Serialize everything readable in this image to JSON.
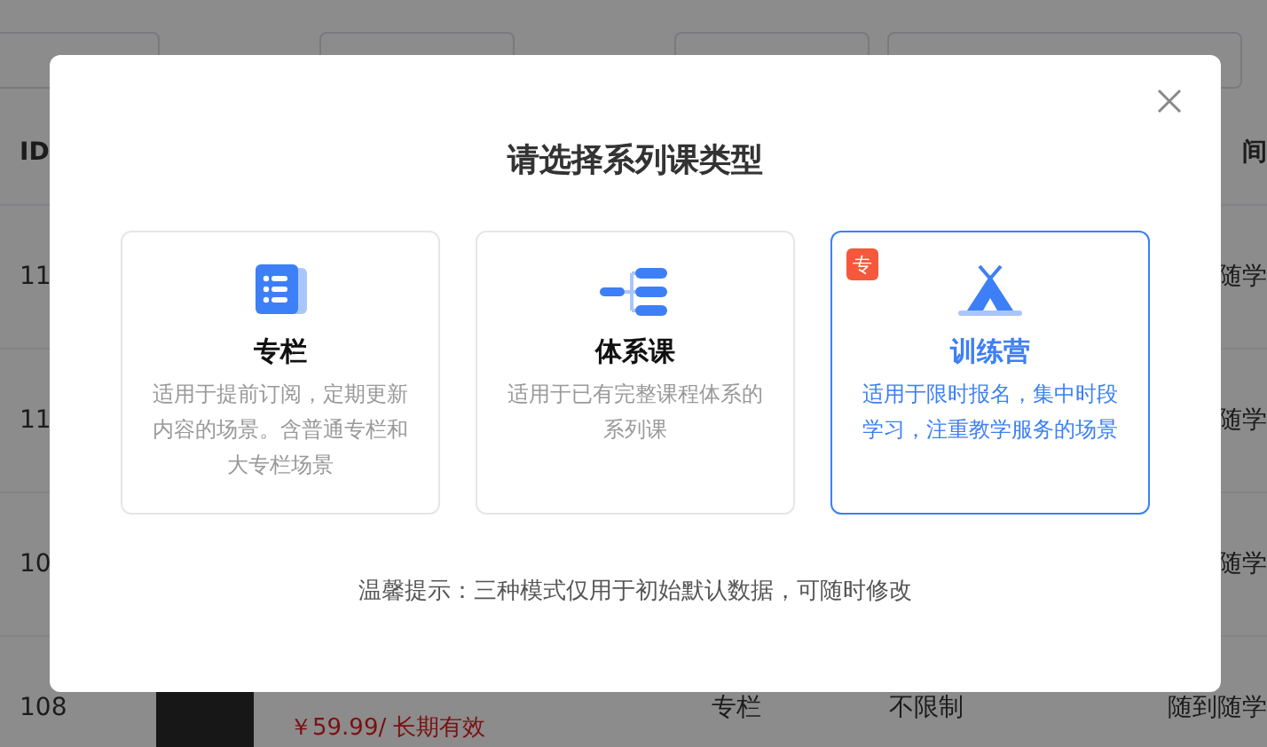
{
  "filters": [
    {
      "kind": "select"
    },
    {
      "kind": "select"
    },
    {
      "kind": "select"
    }
  ],
  "table": {
    "columns": [
      "ID",
      "间"
    ],
    "rows": [
      {
        "id": "11",
        "column_5": "随学"
      },
      {
        "id": "11",
        "column_5": "随学"
      },
      {
        "id": "10",
        "column_5": "随学"
      },
      {
        "id": "108",
        "price": "￥59.99/ 长期有效",
        "type": "专栏",
        "limit": "不限制",
        "column_5": "随到随学"
      }
    ]
  },
  "dialog": {
    "title": "请选择系列课类型",
    "options": [
      {
        "kind": "column",
        "title": "专栏",
        "description": "适用于提前订阅，定期更新内容的场景。含普通专栏和大专栏场景",
        "selected": false
      },
      {
        "kind": "system",
        "title": "体系课",
        "description": "适用于已有完整课程体系的系列课",
        "selected": false
      },
      {
        "kind": "camp",
        "title": "训练营",
        "description": "适用于限时报名，集中时段学习，注重教学服务的场景",
        "selected": true,
        "badge": "专"
      }
    ],
    "tip": "温馨提示：三种模式仅用于初始默认数据，可随时修改"
  }
}
